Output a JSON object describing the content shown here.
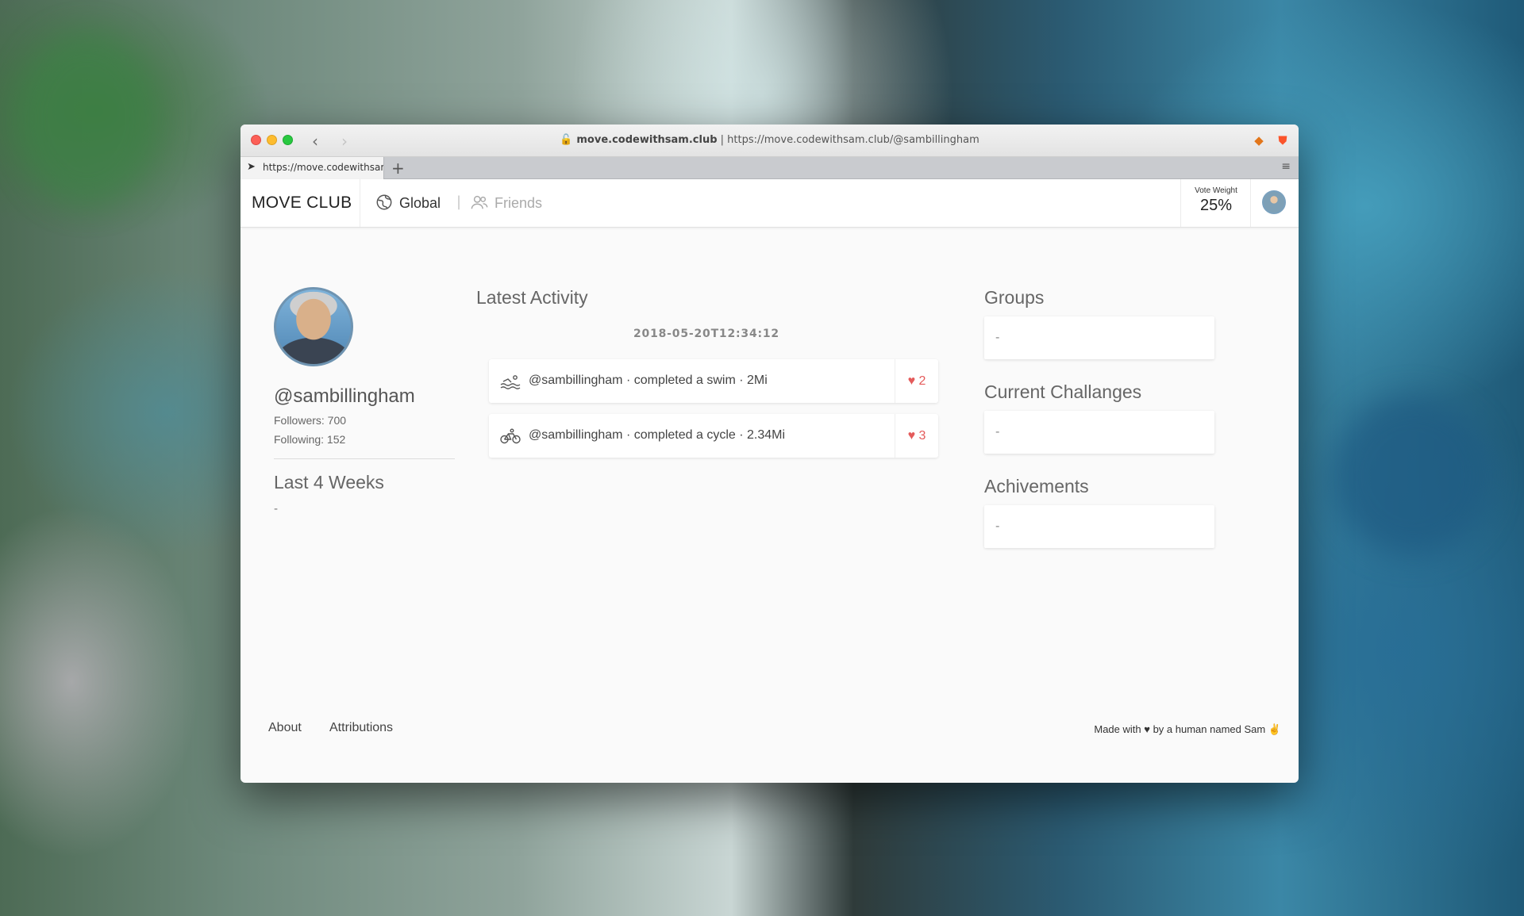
{
  "browser": {
    "url_host": "move.codewithsam.club",
    "url_full": "https://move.codewithsam.club/@sambillingham",
    "tab_title": "https://move.codewithsam.club/@sambillingham",
    "new_tab": "+",
    "tab_menu": "≡"
  },
  "header": {
    "brand": "MOVE CLUB",
    "nav": {
      "global": "Global",
      "separator": "|",
      "friends": "Friends"
    },
    "vote_weight_label": "Vote Weight",
    "vote_weight_value": "25%"
  },
  "profile": {
    "username": "@sambillingham",
    "followers": "Followers: 700",
    "following": "Following: 152",
    "last_weeks_title": "Last 4 Weeks",
    "last_weeks_value": "-"
  },
  "activity": {
    "title": "Latest Activity",
    "date": "2018-05-20T12:34:12",
    "items": [
      {
        "icon": "swim-icon",
        "text": "@sambillingham · completed a swim · 2Mi",
        "likes": "♥ 2"
      },
      {
        "icon": "cycle-icon",
        "text": "@sambillingham · completed a cycle · 2.34Mi",
        "likes": "♥ 3"
      }
    ]
  },
  "sidebar": {
    "groups_title": "Groups",
    "groups_value": "-",
    "challenges_title": "Current Challanges",
    "challenges_value": "-",
    "achievements_title": "Achivements",
    "achievements_value": "-"
  },
  "footer": {
    "about": "About",
    "attributions": "Attributions",
    "credit": "Made with ♥ by a human named Sam ✌"
  },
  "colors": {
    "like": "#e45b5b",
    "avatar_ring": "#6f94b1",
    "traffic_red": "#fc5f57",
    "traffic_yellow": "#fdbc2e",
    "traffic_green": "#28c840"
  }
}
